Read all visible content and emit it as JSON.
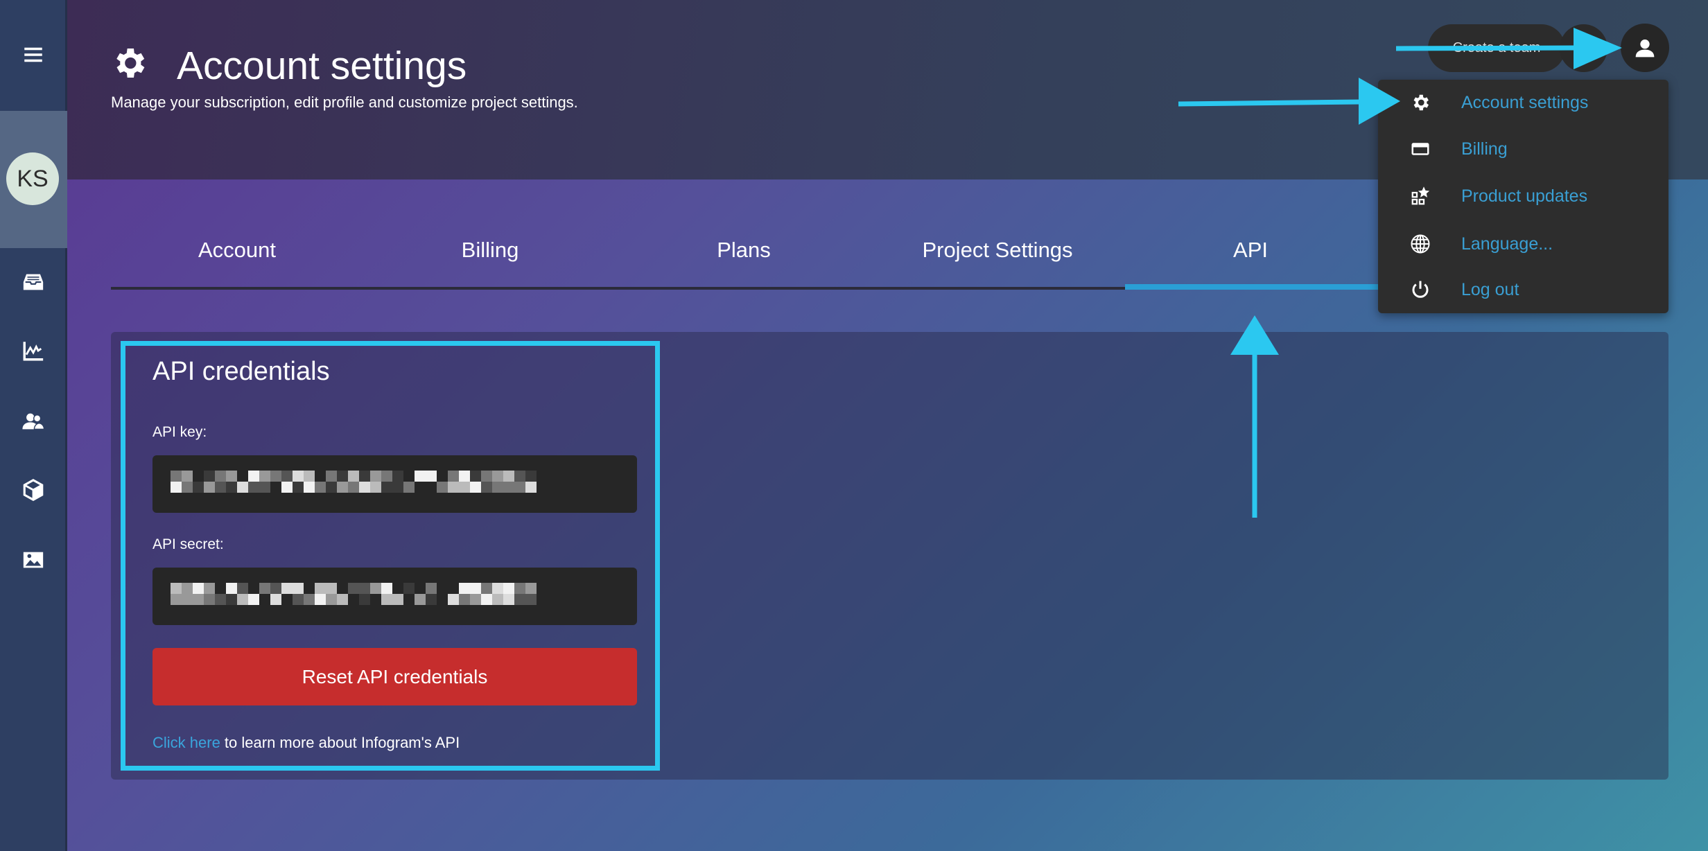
{
  "header": {
    "title": "Account settings",
    "subtitle": "Manage your subscription, edit profile and customize project settings."
  },
  "sidebar": {
    "avatar_initials": "KS",
    "items": [
      "menu-icon",
      "inbox-icon",
      "chart-icon",
      "team-icon",
      "cube-icon",
      "image-icon"
    ]
  },
  "tabs": [
    {
      "label": "Account"
    },
    {
      "label": "Billing"
    },
    {
      "label": "Plans"
    },
    {
      "label": "Project Settings"
    },
    {
      "label": "API",
      "active": true
    }
  ],
  "api": {
    "title": "API credentials",
    "key_label": "API key:",
    "secret_label": "API secret:",
    "reset_label": "Reset API credentials",
    "link_text": "Click here",
    "link_suffix": " to learn more about Infogram's API"
  },
  "topbar": {
    "create_team_label": "Create a team"
  },
  "menu": {
    "items": [
      {
        "label": "Account settings",
        "icon": "gear-icon"
      },
      {
        "label": "Billing",
        "icon": "credit-card-icon"
      },
      {
        "label": "Product updates",
        "icon": "product-updates-icon"
      },
      {
        "label": "Language...",
        "icon": "globe-icon"
      },
      {
        "label": "Log out",
        "icon": "power-icon"
      }
    ]
  },
  "colors": {
    "accent": "#2a9fd6",
    "annotation": "#2bc8f0",
    "danger": "#c62d2d",
    "menu_text": "#3a9fd3"
  }
}
